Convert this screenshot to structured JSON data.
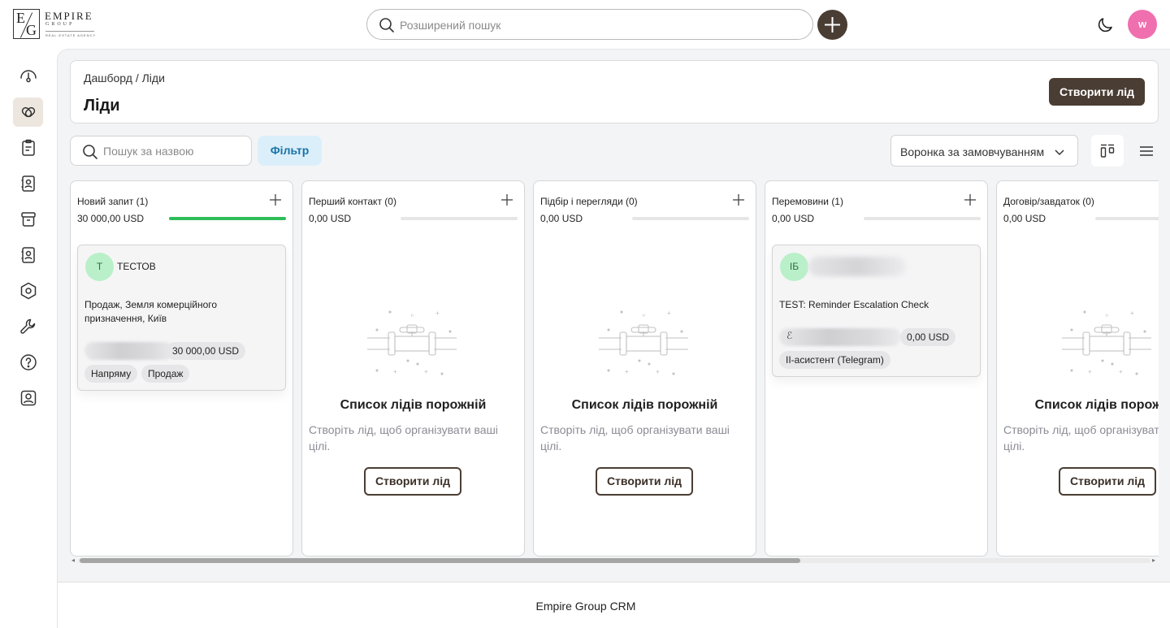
{
  "brand": {
    "letter1": "E",
    "letter2": "G",
    "name": "EMPIRE",
    "sub": "GROUP",
    "tagline": "REAL ESTATE AGENCY"
  },
  "topbar": {
    "search_placeholder": "Розширений пошук",
    "user_initial": "w",
    "avatar_color": "#f06fae",
    "accent_color": "#4a3d33"
  },
  "sidebar": {
    "items": [
      {
        "icon": "dashboard-gauge-icon",
        "active": false
      },
      {
        "icon": "leads-link-icon",
        "active": true
      },
      {
        "icon": "clipboard-icon",
        "active": false
      },
      {
        "icon": "contacts-book-icon",
        "active": false
      },
      {
        "icon": "archive-box-icon",
        "active": false
      },
      {
        "icon": "address-book-icon",
        "active": false
      },
      {
        "icon": "settings-hexagon-icon",
        "active": false
      },
      {
        "icon": "wrench-icon",
        "active": false
      },
      {
        "icon": "help-circle-icon",
        "active": false
      },
      {
        "icon": "profile-icon",
        "active": false
      }
    ]
  },
  "header": {
    "breadcrumb": "Дашборд / Ліди",
    "title": "Ліди",
    "create_button": "Створити лід"
  },
  "toolbar": {
    "search_placeholder": "Пошук за назвою",
    "filter_label": "Фільтр",
    "funnel_value": "Воронка за замовчуванням"
  },
  "columns": [
    {
      "title": "Новий запит (1)",
      "sum": "30 000,00 USD",
      "progress": 1.0,
      "card": {
        "avatar": "Т",
        "name": "ТЕСТОВ",
        "description": "Продаж, Земля комерційного призначення, Київ",
        "amount": "30 000,00 USD",
        "tags": [
          "Напряму",
          "Продаж"
        ]
      }
    },
    {
      "title": "Перший контакт (0)",
      "sum": "0,00 USD",
      "progress": 0,
      "empty": {
        "title": "Список лідів порожній",
        "text": "Створіть лід, щоб організувати ваші цілі.",
        "button": "Створити лід"
      }
    },
    {
      "title": "Підбір і перегляди (0)",
      "sum": "0,00 USD",
      "progress": 0,
      "empty": {
        "title": "Список лідів порожній",
        "text": "Створіть лід, щоб організувати ваші цілі.",
        "button": "Створити лід"
      }
    },
    {
      "title": "Перемовини (1)",
      "sum": "0,00 USD",
      "progress": 0,
      "card": {
        "avatar": "ІБ",
        "name": "",
        "description": "TEST: Reminder Escalation Check",
        "amount": "0,00 USD",
        "tags": [
          "ІІ-асистент (Telegram)"
        ]
      }
    },
    {
      "title": "Договір/завдаток (0)",
      "sum": "0,00 USD",
      "progress": 0,
      "empty": {
        "title": "Список лідів порожній",
        "text": "Створіть лід, щоб організувати ваші цілі.",
        "button": "Створити лід"
      }
    }
  ],
  "footer": {
    "text": "Empire Group CRM"
  }
}
